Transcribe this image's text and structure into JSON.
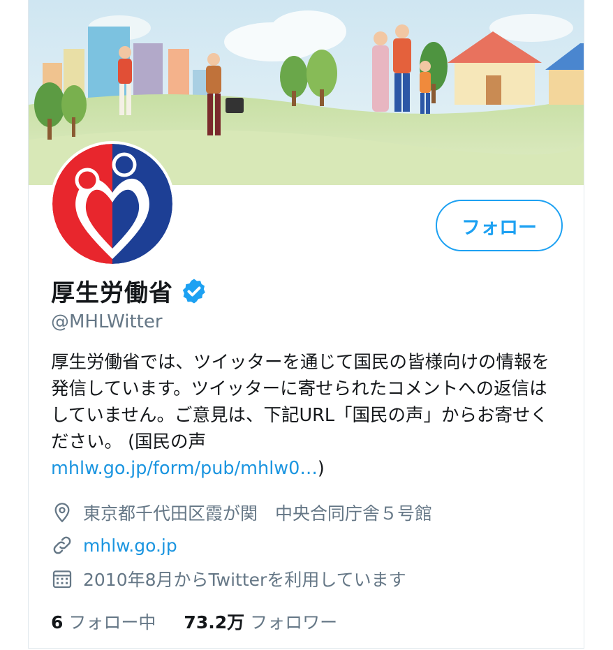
{
  "profile": {
    "name": "厚生労働省",
    "handle": "@MHLWitter",
    "verified": true,
    "follow_label": "フォロー",
    "bio_text": "厚生労働省では、ツイッターを通じて国民の皆様向けの情報を発信しています。ツイッターに寄せられたコメントへの返信はしていません。ご意見は、下記URL「国民の声」からお寄せください。 (国民の声 ",
    "bio_link": "mhlw.go.jp/form/pub/mhlw0…",
    "bio_close": ")",
    "location": "東京都千代田区霞が関　中央合同庁舎５号館",
    "website": "mhlw.go.jp",
    "joined": "2010年8月からTwitterを利用しています",
    "following_count": "6",
    "following_label": "フォロー中",
    "followers_count": "73.2万",
    "followers_label": "フォロワー"
  },
  "icons": {
    "location": "location-pin-icon",
    "website": "link-icon",
    "joined": "calendar-icon",
    "verified": "verified-badge-icon"
  },
  "colors": {
    "accent": "#1da1f2",
    "link": "#1b95e0",
    "muted": "#657786",
    "logo_red": "#e8262d",
    "logo_blue": "#1d3f95"
  }
}
